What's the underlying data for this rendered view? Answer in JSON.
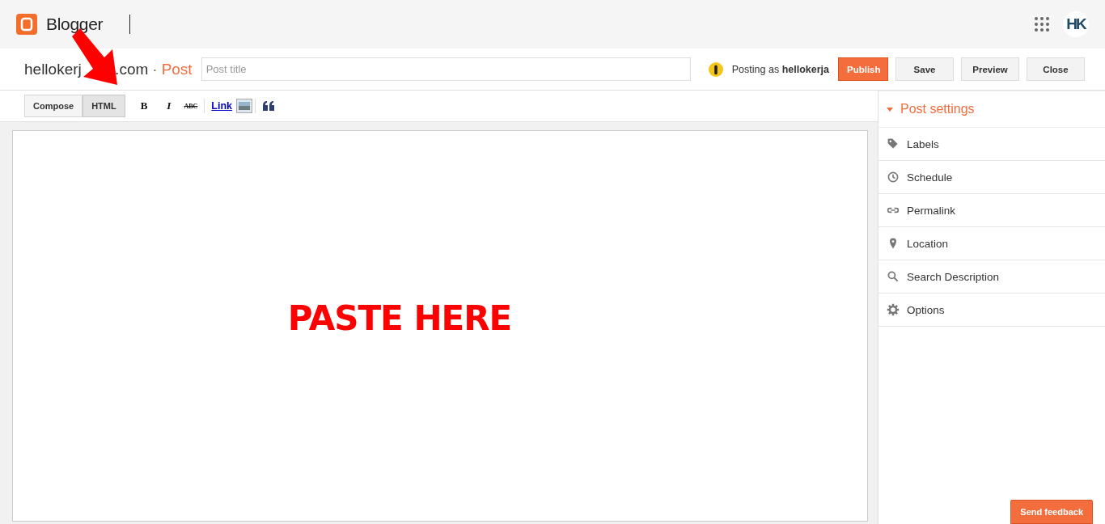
{
  "header": {
    "brand": "Blogger",
    "avatar": "HK"
  },
  "post_bar": {
    "blog_parts": [
      "hellokerj",
      ".com"
    ],
    "separator": "·",
    "section": "Post",
    "title_placeholder": "Post title",
    "posting_as": "Posting as **hellokerja**",
    "buttons": [
      {
        "label": "Publish",
        "kind": "primary"
      },
      {
        "label": "Save",
        "kind": "plain"
      },
      {
        "label": "Preview",
        "kind": "plain"
      },
      {
        "label": "Close",
        "kind": "plain"
      }
    ]
  },
  "mode_tabs": [
    {
      "label": "Compose",
      "selected": false
    },
    {
      "label": "HTML",
      "selected": true
    }
  ],
  "format_buttons": [
    {
      "label": "B",
      "kind": "bold"
    },
    {
      "label": "I",
      "kind": "italic"
    },
    {
      "label": "ABC",
      "kind": "strike"
    }
  ],
  "link": "Link",
  "annotation": "PASTE HERE",
  "sidebar": {
    "title": "Post settings",
    "items": [
      {
        "label": "Labels",
        "kind": "tag"
      },
      {
        "label": "Schedule",
        "kind": "clock"
      },
      {
        "label": "Permalink",
        "kind": "link"
      },
      {
        "label": "Location",
        "kind": "pin"
      },
      {
        "label": "Search Description",
        "kind": "search"
      },
      {
        "label": "Options",
        "kind": "gear"
      }
    ]
  },
  "feedback": "Send feedback"
}
